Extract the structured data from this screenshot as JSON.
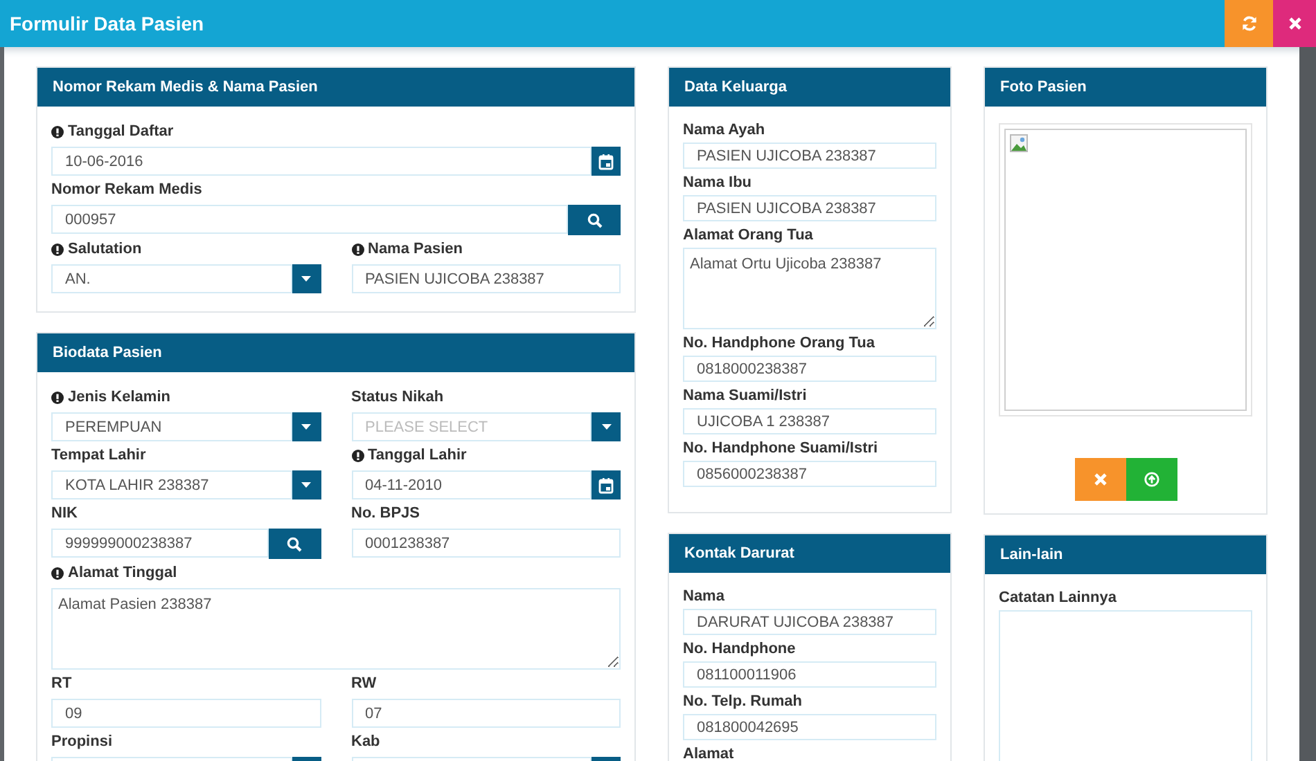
{
  "window": {
    "title": "Formulir Data Pasien"
  },
  "columns": [
    {
      "panels": [
        {
          "title": "Nomor Rekam Medis & Nama Pasien",
          "rows": [
            [
              {
                "kind": "date",
                "label": "Tanggal Daftar",
                "required": true,
                "value": "10-06-2016"
              }
            ],
            [
              {
                "kind": "search",
                "label": "Nomor Rekam Medis",
                "required": false,
                "value": "000957"
              }
            ],
            [
              {
                "kind": "select",
                "label": "Salutation",
                "required": true,
                "value": "AN."
              },
              {
                "kind": "text",
                "label": "Nama Pasien",
                "required": true,
                "value": "PASIEN UJICOBA 238387"
              }
            ]
          ]
        },
        {
          "title": "Biodata Pasien",
          "rows": [
            [
              {
                "kind": "select",
                "label": "Jenis Kelamin",
                "required": true,
                "value": "PEREMPUAN"
              },
              {
                "kind": "select",
                "label": "Status Nikah",
                "required": false,
                "placeholder": "PLEASE SELECT"
              }
            ],
            [
              {
                "kind": "select",
                "label": "Tempat Lahir",
                "required": false,
                "value": "KOTA LAHIR 238387"
              },
              {
                "kind": "date",
                "label": "Tanggal Lahir",
                "required": true,
                "value": "04-11-2010"
              }
            ],
            [
              {
                "kind": "search",
                "label": "NIK",
                "required": false,
                "value": "999999000238387"
              },
              {
                "kind": "text",
                "label": "No. BPJS",
                "required": false,
                "value": "0001238387"
              }
            ],
            [
              {
                "kind": "textarea",
                "label": "Alamat Tinggal",
                "required": true,
                "value": "Alamat Pasien 238387"
              }
            ],
            [
              {
                "kind": "text",
                "label": "RT",
                "required": false,
                "value": "09"
              },
              {
                "kind": "text",
                "label": "RW",
                "required": false,
                "value": "07"
              }
            ],
            [
              {
                "kind": "select",
                "label": "Propinsi",
                "required": false
              },
              {
                "kind": "select",
                "label": "Kab",
                "required": false
              }
            ]
          ]
        }
      ]
    },
    {
      "panels": [
        {
          "title": "Data Keluarga",
          "rows": [
            [
              {
                "kind": "text",
                "label": "Nama Ayah",
                "required": false,
                "value": "PASIEN UJICOBA 238387"
              }
            ],
            [
              {
                "kind": "text",
                "label": "Nama Ibu",
                "required": false,
                "value": "PASIEN UJICOBA 238387"
              }
            ],
            [
              {
                "kind": "textarea",
                "label": "Alamat Orang Tua",
                "required": false,
                "value": "Alamat Ortu Ujicoba 238387"
              }
            ],
            [
              {
                "kind": "text",
                "label": "No. Handphone Orang Tua",
                "required": false,
                "value": "0818000238387"
              }
            ],
            [
              {
                "kind": "text",
                "label": "Nama Suami/Istri",
                "required": false,
                "value": "UJICOBA 1 238387"
              }
            ],
            [
              {
                "kind": "text",
                "label": "No. Handphone Suami/Istri",
                "required": false,
                "value": "0856000238387"
              }
            ]
          ]
        },
        {
          "title": "Kontak Darurat",
          "rows": [
            [
              {
                "kind": "text",
                "label": "Nama",
                "required": false,
                "value": "DARURAT UJICOBA 238387"
              }
            ],
            [
              {
                "kind": "text",
                "label": "No. Handphone",
                "required": false,
                "value": "081100011906"
              }
            ],
            [
              {
                "kind": "text",
                "label": "No. Telp. Rumah",
                "required": false,
                "value": "081800042695"
              }
            ],
            [
              {
                "kind": "label",
                "label": "Alamat",
                "required": false
              }
            ]
          ]
        }
      ]
    },
    {
      "panels": [
        {
          "title": "Foto Pasien",
          "rows": [
            [
              {
                "kind": "photo"
              }
            ]
          ]
        },
        {
          "title": "Lain-lain",
          "rows": [
            [
              {
                "kind": "textarea",
                "label": "Catatan Lainnya",
                "required": false
              }
            ]
          ]
        }
      ]
    }
  ]
}
